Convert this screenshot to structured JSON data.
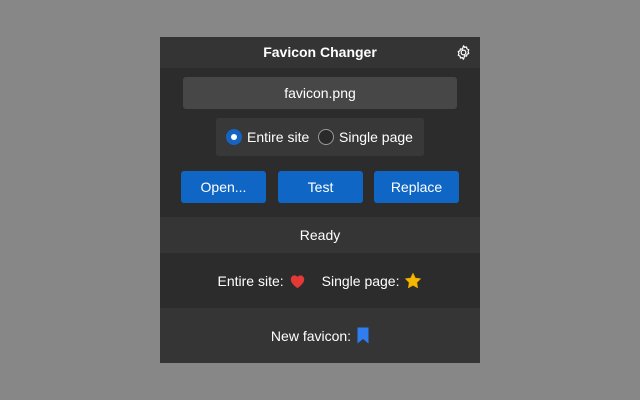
{
  "window": {
    "title": "Favicon Changer"
  },
  "file_field": {
    "value": "favicon.png"
  },
  "scope": {
    "options": [
      "Entire site",
      "Single page"
    ],
    "selected": "Entire site"
  },
  "buttons": {
    "open": "Open...",
    "test": "Test",
    "replace": "Replace"
  },
  "status": {
    "text": "Ready"
  },
  "current_icons": {
    "entire_site_label": "Entire site:",
    "entire_site_icon": "heart-icon",
    "single_page_label": "Single page:",
    "single_page_icon": "star-icon"
  },
  "new_favicon": {
    "label": "New favicon:",
    "icon": "bookmark-icon"
  },
  "colors": {
    "accent": "#0f66c4",
    "heart": "#e53935",
    "star": "#f5b700",
    "bookmark": "#2f7ef0"
  }
}
